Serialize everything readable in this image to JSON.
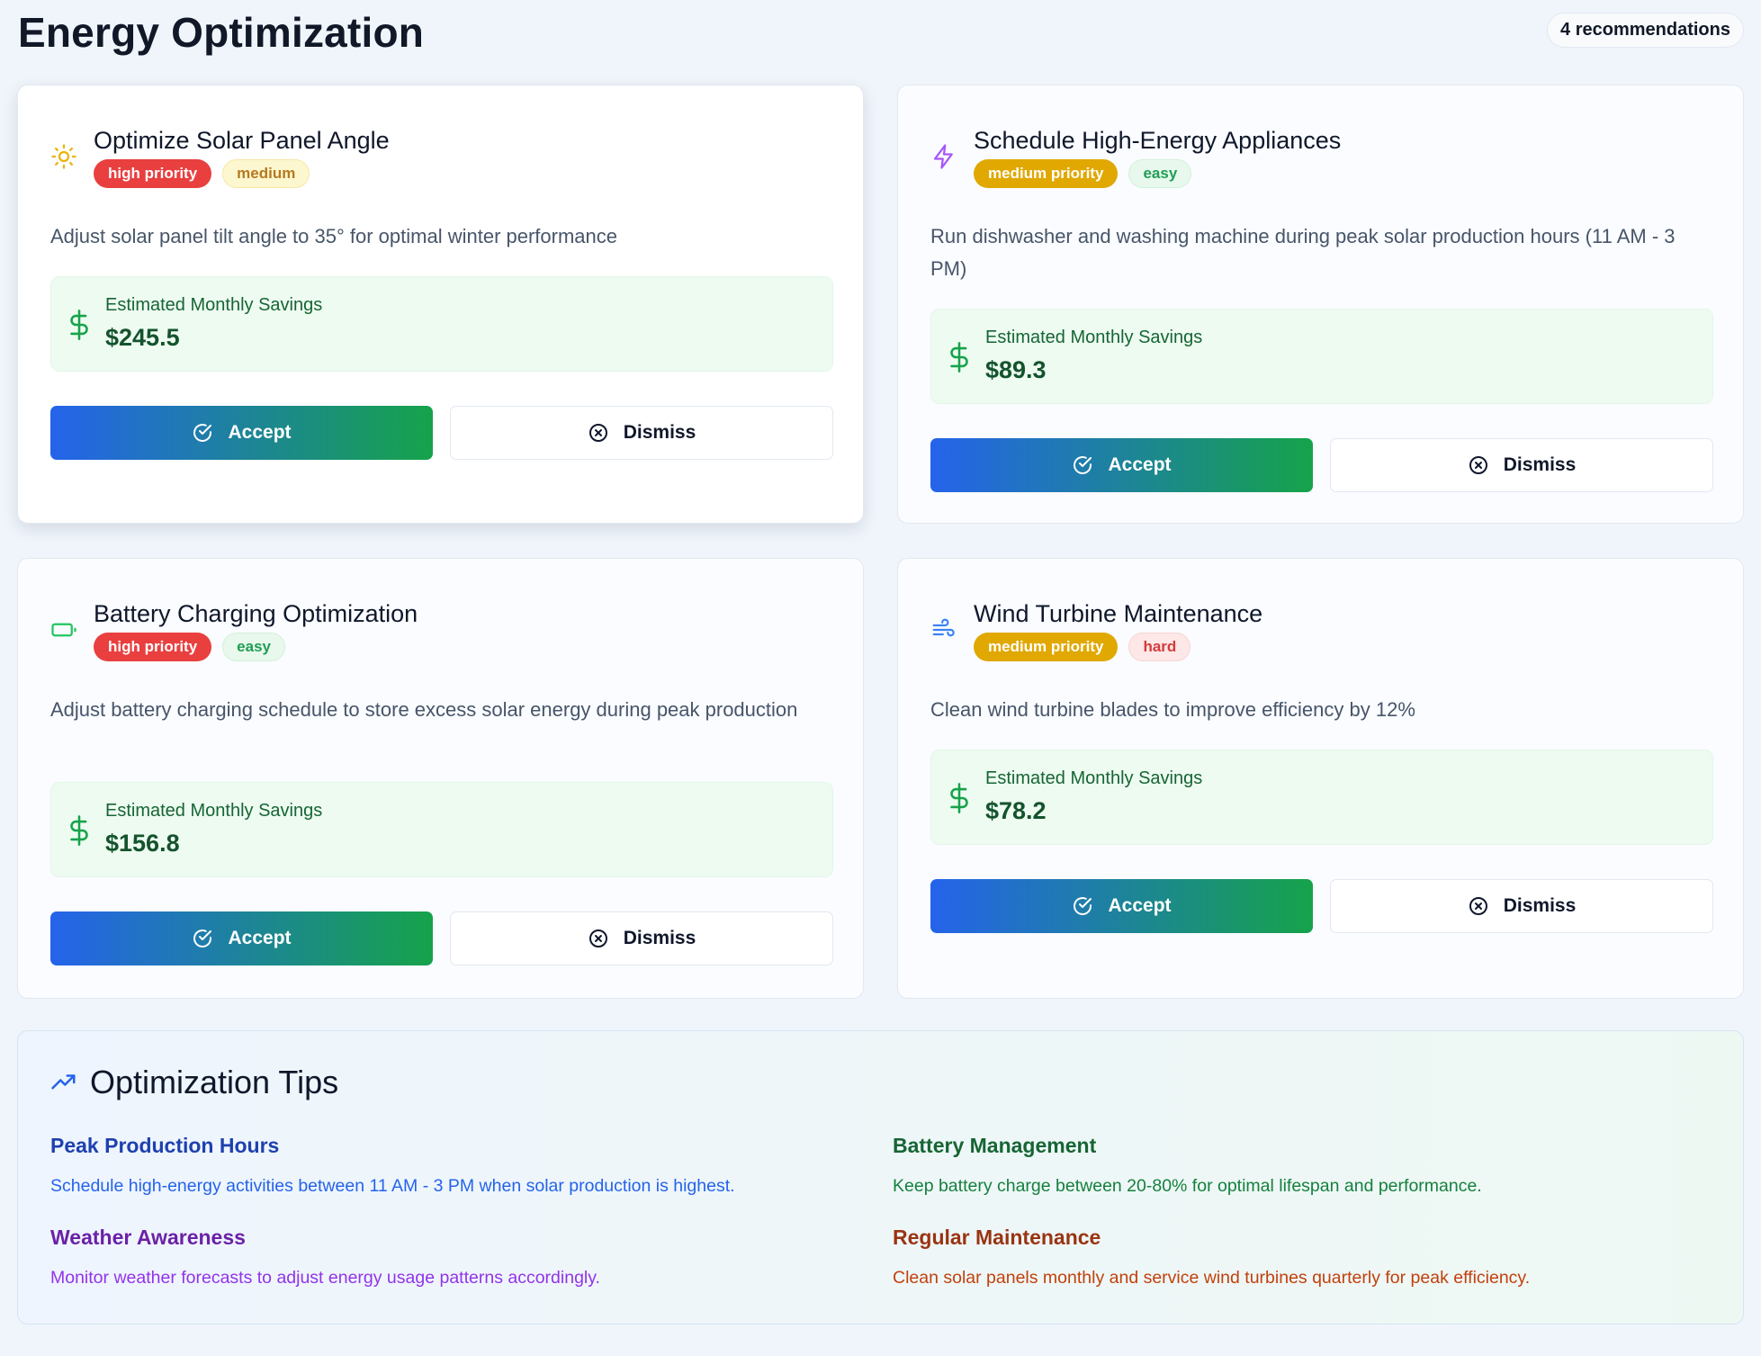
{
  "header": {
    "title": "Energy Optimization",
    "count_badge": "4 recommendations"
  },
  "colors": {
    "high_priority": "#e93f3f",
    "medium_priority": "#e0a800",
    "accept_gradient_start": "#2563eb",
    "accept_gradient_end": "#16a34a",
    "savings_background": "#eefbf1"
  },
  "savings_label": "Estimated Monthly Savings",
  "accept_label": "Accept",
  "dismiss_label": "Dismiss",
  "recommendations": [
    {
      "icon": "sun-icon",
      "title": "Optimize Solar Panel Angle",
      "priority": "high priority",
      "difficulty": "medium",
      "description": "Adjust solar panel tilt angle to 35° for optimal winter performance",
      "savings": "$245.5"
    },
    {
      "icon": "lightning-icon",
      "title": "Schedule High-Energy Appliances",
      "priority": "medium priority",
      "difficulty": "easy",
      "description": "Run dishwasher and washing machine during peak solar production hours (11 AM - 3 PM)",
      "savings": "$89.3"
    },
    {
      "icon": "battery-icon",
      "title": "Battery Charging Optimization",
      "priority": "high priority",
      "difficulty": "easy",
      "description": "Adjust battery charging schedule to store excess solar energy during peak production",
      "savings": "$156.8"
    },
    {
      "icon": "wind-icon",
      "title": "Wind Turbine Maintenance",
      "priority": "medium priority",
      "difficulty": "hard",
      "description": "Clean wind turbine blades to improve efficiency by 12%",
      "savings": "$78.2"
    }
  ],
  "tips": {
    "icon": "trending-up-icon",
    "title": "Optimization Tips",
    "items": [
      {
        "title": "Peak Production Hours",
        "text": "Schedule high-energy activities between 11 AM - 3 PM when solar production is highest."
      },
      {
        "title": "Battery Management",
        "text": "Keep battery charge between 20-80% for optimal lifespan and performance."
      },
      {
        "title": "Weather Awareness",
        "text": "Monitor weather forecasts to adjust energy usage patterns accordingly."
      },
      {
        "title": "Regular Maintenance",
        "text": "Clean solar panels monthly and service wind turbines quarterly for peak efficiency."
      }
    ]
  }
}
